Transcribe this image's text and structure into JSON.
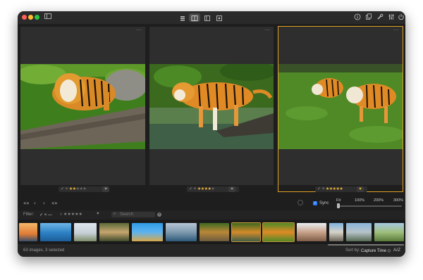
{
  "toolbar": {
    "view_modes": [
      "grid-view-icon",
      "compare-view-icon",
      "single-view-icon",
      "detail-view-icon"
    ],
    "right_icons": [
      "info-icon",
      "share-icon",
      "tools-icon",
      "adjust-icon",
      "power-icon"
    ]
  },
  "panels": [
    {
      "stars": 2,
      "check": "✓ ×"
    },
    {
      "stars": 4,
      "check": "✓ ×"
    },
    {
      "stars": 5,
      "check": "✓ ×",
      "selected": true
    }
  ],
  "nav": {
    "first": "«»",
    "prev": "‹",
    "next": "›",
    "last": "«»"
  },
  "sync": {
    "label": "Sync",
    "checked": true
  },
  "zoom": {
    "fit": "Fit",
    "z100": "100%",
    "z200": "200%",
    "z300": "300%"
  },
  "filter": {
    "label": "Filter:",
    "flags": "✓ × —",
    "search_placeholder": "Search"
  },
  "status": {
    "count": "63 images, 3 selected",
    "sort_label": "Sort by:",
    "sort_value": "Capture Time ◇",
    "sort_dir": "A/Z"
  },
  "colors": {
    "accent": "#e0a024",
    "star": "#f0b43c",
    "window": "#1e1e1e",
    "panel": "#2e2e2e"
  }
}
